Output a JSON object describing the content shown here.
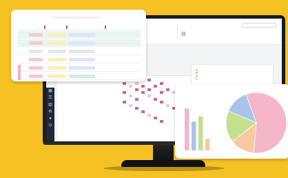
{
  "colors": {
    "background": "#f6c223",
    "accent_pink": "#f4b6c8",
    "bar_blue": "#a8c4ea",
    "bar_green": "#c3e08f",
    "bar_peach": "#f8c9a0",
    "matrix_mark": "#c96a8c"
  },
  "dashboard": {
    "search": {
      "placeholder": ""
    },
    "stats": [
      {
        "icon": "server-icon",
        "label": "",
        "value": ""
      },
      {
        "icon": "server-icon",
        "label": "",
        "value": ""
      }
    ],
    "section_title": "",
    "legend_link": "",
    "legend_panel": {
      "title": "",
      "items": [
        {
          "color": "#f4b6c8",
          "label": ""
        },
        {
          "color": "#a8c4ea",
          "label": ""
        },
        {
          "color": "#c3e08f",
          "label": ""
        },
        {
          "color": "#f8c9a0",
          "label": ""
        }
      ]
    },
    "rail_icons": [
      "grid-icon",
      "list-icon",
      "chart-icon",
      "settings-icon",
      "user-icon",
      "logout-icon"
    ]
  },
  "table_card": {
    "title": "",
    "columns": [
      "",
      "",
      "",
      ""
    ],
    "rows": [
      {
        "num": "",
        "selected": true,
        "cells": [
          "",
          "",
          ""
        ]
      },
      {
        "num": "",
        "selected": true,
        "cells": [
          "",
          "",
          ""
        ]
      },
      {
        "num": "",
        "selected": false,
        "cells": [
          "",
          "",
          ""
        ]
      },
      {
        "num": "",
        "selected": false,
        "cells": [
          "",
          "",
          ""
        ]
      },
      {
        "num": "",
        "selected": false,
        "cells": [
          "",
          "",
          ""
        ]
      },
      {
        "num": "",
        "selected": false,
        "cells": [
          "",
          "",
          ""
        ]
      }
    ]
  },
  "chart_data": [
    {
      "type": "bar",
      "categories": [
        "",
        "",
        "",
        ""
      ],
      "values": [
        80,
        55,
        65,
        22
      ],
      "ylim": [
        0,
        100
      ],
      "colors": [
        "#f4b6c8",
        "#a8c4ea",
        "#c3e08f",
        "#f8c9a0"
      ],
      "title": "",
      "xlabel": "",
      "ylabel": ""
    },
    {
      "type": "pie",
      "labels": [
        "",
        "",
        "",
        ""
      ],
      "values": [
        57,
        13,
        17,
        13
      ],
      "colors": [
        "#f4b6c8",
        "#f8c9a0",
        "#c3e08f",
        "#a8c4ea"
      ],
      "title": ""
    }
  ]
}
